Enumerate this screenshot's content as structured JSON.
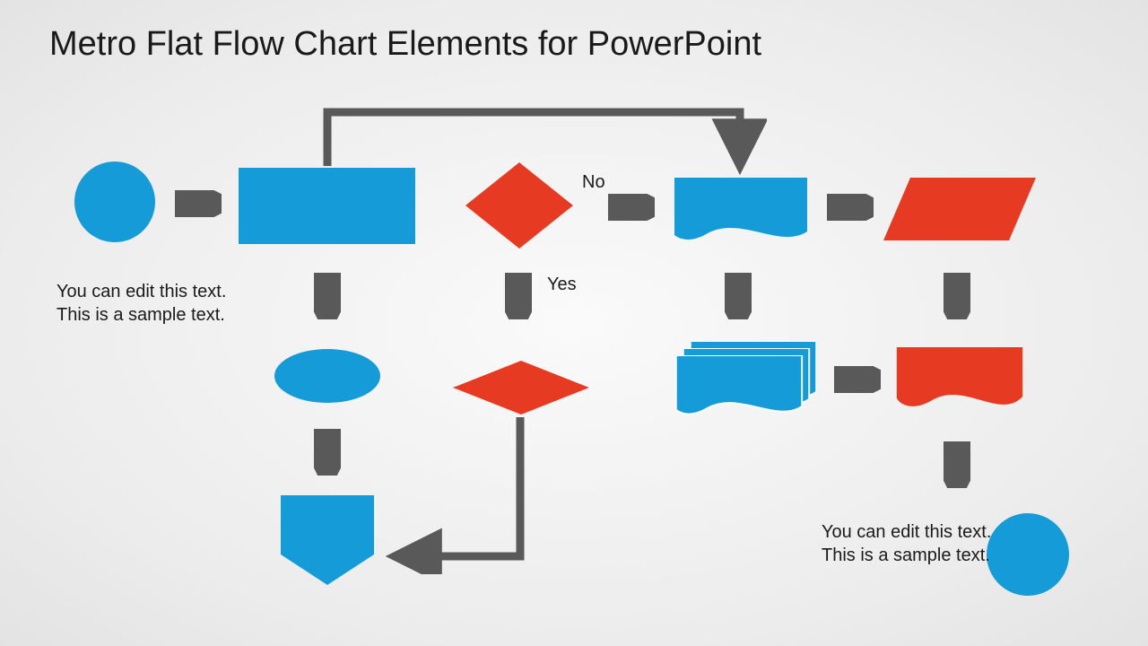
{
  "title": "Metro Flat Flow Chart Elements for PowerPoint",
  "caption_left": "You can edit this text. This is a sample text.",
  "caption_right": "You can edit this text. This is a sample text.",
  "labels": {
    "no": "No",
    "yes": "Yes"
  },
  "colors": {
    "blue": "#159bd7",
    "red": "#e63a22",
    "arrow": "#595959"
  }
}
